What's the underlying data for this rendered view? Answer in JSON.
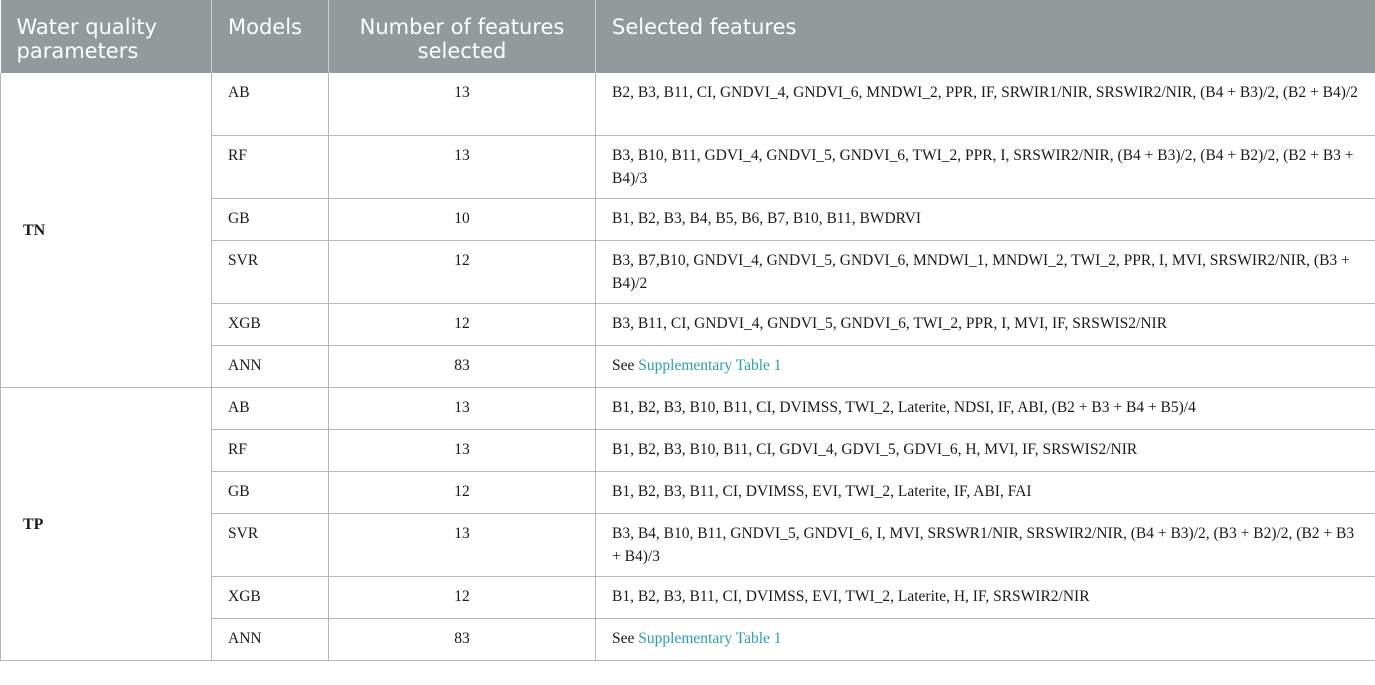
{
  "table": {
    "headers": [
      "Water quality parameters",
      "Models",
      "Number of features selected",
      "Selected features"
    ],
    "groups": [
      {
        "parameter": "TN",
        "rows": [
          {
            "model": "AB",
            "count": "13",
            "features": "B2, B3, B11, CI, GNDVI_4, GNDVI_6, MNDWI_2, PPR, IF, SRWIR1/NIR, SRSWIR2/NIR, (B4 + B3)/2, (B2 + B4)/2"
          },
          {
            "model": "RF",
            "count": "13",
            "features": "B3, B10, B11, GDVI_4, GNDVI_5, GNDVI_6, TWI_2, PPR, I, SRSWIR2/NIR, (B4 + B3)/2, (B4 + B2)/2, (B2 + B3 + B4)/3"
          },
          {
            "model": "GB",
            "count": "10",
            "features": "B1, B2, B3, B4, B5, B6, B7, B10, B11, BWDRVI"
          },
          {
            "model": "SVR",
            "count": "12",
            "features": "B3, B7,B10, GNDVI_4, GNDVI_5, GNDVI_6, MNDWI_1, MNDWI_2, TWI_2, PPR, I, MVI, SRSWIR2/NIR, (B3 + B4)/2"
          },
          {
            "model": "XGB",
            "count": "12",
            "features": "B3, B11, CI, GNDVI_4, GNDVI_5, GNDVI_6, TWI_2, PPR, I, MVI, IF, SRSWIS2/NIR"
          },
          {
            "model": "ANN",
            "count": "83",
            "features_prefix": "See ",
            "features_link": "Supplementary Table 1"
          }
        ]
      },
      {
        "parameter": "TP",
        "rows": [
          {
            "model": "AB",
            "count": "13",
            "features": "B1, B2, B3, B10, B11, CI, DVIMSS, TWI_2, Laterite, NDSI, IF, ABI, (B2 + B3 + B4 + B5)/4"
          },
          {
            "model": "RF",
            "count": "13",
            "features": "B1, B2, B3, B10, B11, CI, GDVI_4, GDVI_5, GDVI_6, H, MVI, IF, SRSWIS2/NIR"
          },
          {
            "model": "GB",
            "count": "12",
            "features": "B1, B2, B3, B11, CI, DVIMSS, EVI, TWI_2, Laterite, IF, ABI, FAI"
          },
          {
            "model": "SVR",
            "count": "13",
            "features": "B3, B4, B10, B11, GNDVI_5, GNDVI_6, I, MVI, SRSWR1/NIR, SRSWIR2/NIR, (B4 + B3)/2, (B3 + B2)/2, (B2 + B3 + B4)/3"
          },
          {
            "model": "XGB",
            "count": "12",
            "features": "B1, B2, B3, B11, CI, DVIMSS, EVI, TWI_2, Laterite, H, IF, SRSWIR2/NIR"
          },
          {
            "model": "ANN",
            "count": "83",
            "features_prefix": "See ",
            "features_link": "Supplementary Table 1"
          }
        ]
      }
    ]
  }
}
